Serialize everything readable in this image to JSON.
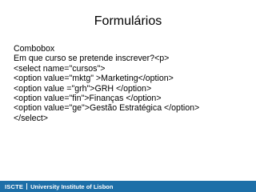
{
  "slide": {
    "title": "Formulários",
    "lines": [
      "Combobox",
      "Em que curso se pretende inscrever?<p>",
      "<select name=\"cursos\">",
      "<option value=\"mktg\" >Marketing</option>",
      "<option value =\"grh\">GRH </option>",
      "<option value=\"fin\">Finanças </option>",
      "<option value=\"ge\">Gestão Estratégica </option>",
      "</select>"
    ]
  },
  "footer": {
    "logo_text": "ISCTE",
    "institution": "University Institute of Lisbon",
    "bar_color": "#1d6fa8"
  }
}
